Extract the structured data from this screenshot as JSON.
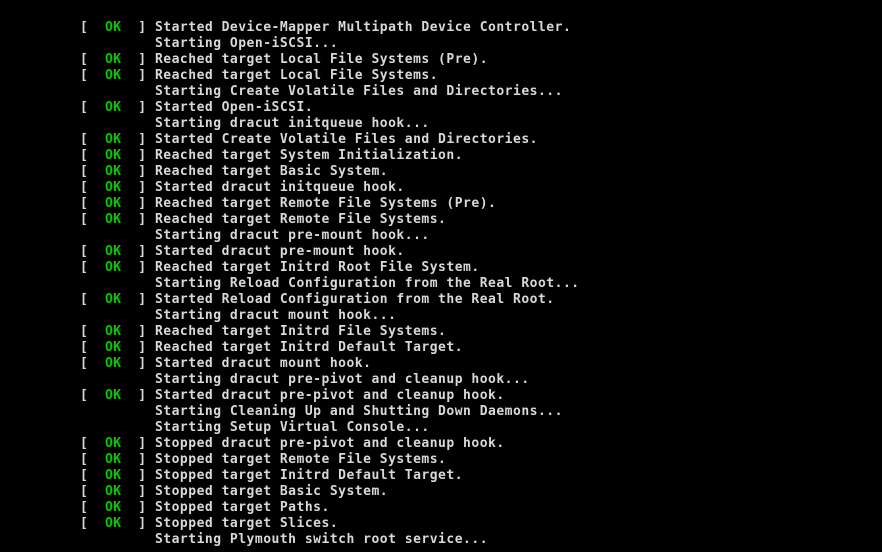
{
  "bracket_open": "[",
  "bracket_close": "]",
  "ok_label": "OK",
  "indent": "         ",
  "lines": [
    {
      "status": "ok",
      "text": "Started Device-Mapper Multipath Device Controller."
    },
    {
      "status": "plain",
      "text": "Starting Open-iSCSI..."
    },
    {
      "status": "ok",
      "text": "Reached target Local File Systems (Pre)."
    },
    {
      "status": "ok",
      "text": "Reached target Local File Systems."
    },
    {
      "status": "plain",
      "text": "Starting Create Volatile Files and Directories..."
    },
    {
      "status": "ok",
      "text": "Started Open-iSCSI."
    },
    {
      "status": "plain",
      "text": "Starting dracut initqueue hook..."
    },
    {
      "status": "ok",
      "text": "Started Create Volatile Files and Directories."
    },
    {
      "status": "ok",
      "text": "Reached target System Initialization."
    },
    {
      "status": "ok",
      "text": "Reached target Basic System."
    },
    {
      "status": "ok",
      "text": "Started dracut initqueue hook."
    },
    {
      "status": "ok",
      "text": "Reached target Remote File Systems (Pre)."
    },
    {
      "status": "ok",
      "text": "Reached target Remote File Systems."
    },
    {
      "status": "plain",
      "text": "Starting dracut pre-mount hook..."
    },
    {
      "status": "ok",
      "text": "Started dracut pre-mount hook."
    },
    {
      "status": "ok",
      "text": "Reached target Initrd Root File System."
    },
    {
      "status": "plain",
      "text": "Starting Reload Configuration from the Real Root..."
    },
    {
      "status": "ok",
      "text": "Started Reload Configuration from the Real Root."
    },
    {
      "status": "plain",
      "text": "Starting dracut mount hook..."
    },
    {
      "status": "ok",
      "text": "Reached target Initrd File Systems."
    },
    {
      "status": "ok",
      "text": "Reached target Initrd Default Target."
    },
    {
      "status": "ok",
      "text": "Started dracut mount hook."
    },
    {
      "status": "plain",
      "text": "Starting dracut pre-pivot and cleanup hook..."
    },
    {
      "status": "ok",
      "text": "Started dracut pre-pivot and cleanup hook."
    },
    {
      "status": "plain",
      "text": "Starting Cleaning Up and Shutting Down Daemons..."
    },
    {
      "status": "plain",
      "text": "Starting Setup Virtual Console..."
    },
    {
      "status": "ok",
      "text": "Stopped dracut pre-pivot and cleanup hook."
    },
    {
      "status": "ok",
      "text": "Stopped target Remote File Systems."
    },
    {
      "status": "ok",
      "text": "Stopped target Initrd Default Target."
    },
    {
      "status": "ok",
      "text": "Stopped target Basic System."
    },
    {
      "status": "ok",
      "text": "Stopped target Paths."
    },
    {
      "status": "ok",
      "text": "Stopped target Slices."
    },
    {
      "status": "plain",
      "text": "Starting Plymouth switch root service..."
    }
  ]
}
